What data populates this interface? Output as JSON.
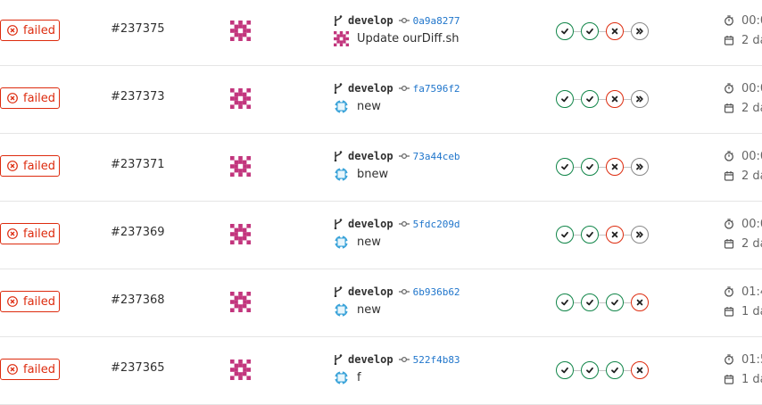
{
  "pipelines": [
    {
      "status": "failed",
      "id": "#237375",
      "branch": "develop",
      "sha": "0a9a8277",
      "message": "Update ourDiff.sh",
      "author": "pink",
      "stages": [
        "passed",
        "passed",
        "failed",
        "skipped"
      ],
      "duration": "00:0",
      "finished": "2 da"
    },
    {
      "status": "failed",
      "id": "#237373",
      "branch": "develop",
      "sha": "fa7596f2",
      "message": "new",
      "author": "blue",
      "stages": [
        "passed",
        "passed",
        "failed",
        "skipped"
      ],
      "duration": "00:0",
      "finished": "2 da"
    },
    {
      "status": "failed",
      "id": "#237371",
      "branch": "develop",
      "sha": "73a44ceb",
      "message": "bnew",
      "author": "blue",
      "stages": [
        "passed",
        "passed",
        "failed",
        "skipped"
      ],
      "duration": "00:0",
      "finished": "2 da"
    },
    {
      "status": "failed",
      "id": "#237369",
      "branch": "develop",
      "sha": "5fdc209d",
      "message": "new",
      "author": "blue",
      "stages": [
        "passed",
        "passed",
        "failed",
        "skipped"
      ],
      "duration": "00:0",
      "finished": "2 da"
    },
    {
      "status": "failed",
      "id": "#237368",
      "branch": "develop",
      "sha": "6b936b62",
      "message": "new",
      "author": "blue",
      "stages": [
        "passed",
        "passed",
        "passed",
        "failed"
      ],
      "duration": "01:4",
      "finished": "1 da"
    },
    {
      "status": "failed",
      "id": "#237365",
      "branch": "develop",
      "sha": "522f4b83",
      "message": "f",
      "author": "blue",
      "stages": [
        "passed",
        "passed",
        "passed",
        "failed"
      ],
      "duration": "01:5",
      "finished": "1 da"
    }
  ],
  "colors": {
    "failed": "#dd2b0e",
    "passed": "#108548",
    "skipped": "#898989",
    "sha": "#1f75cb",
    "identicon_pink": "#c2357d",
    "identicon_blue": "#3aa3d9"
  },
  "icons": {
    "status": "status-failed-icon",
    "branch": "branch-icon",
    "commit": "commit-icon",
    "duration": "timer-icon",
    "finished": "calendar-icon"
  }
}
